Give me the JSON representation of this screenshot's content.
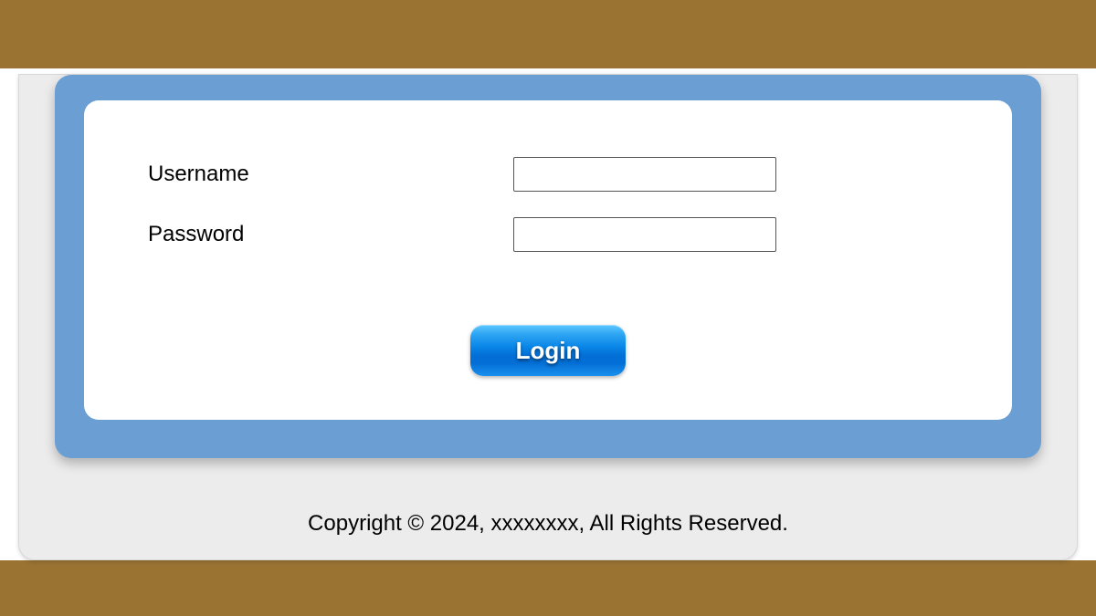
{
  "form": {
    "username_label": "Username",
    "password_label": "Password",
    "username_value": "",
    "password_value": "",
    "login_button_label": "Login"
  },
  "footer": {
    "copyright": "Copyright © 2024, xxxxxxxx, All Rights Reserved."
  }
}
